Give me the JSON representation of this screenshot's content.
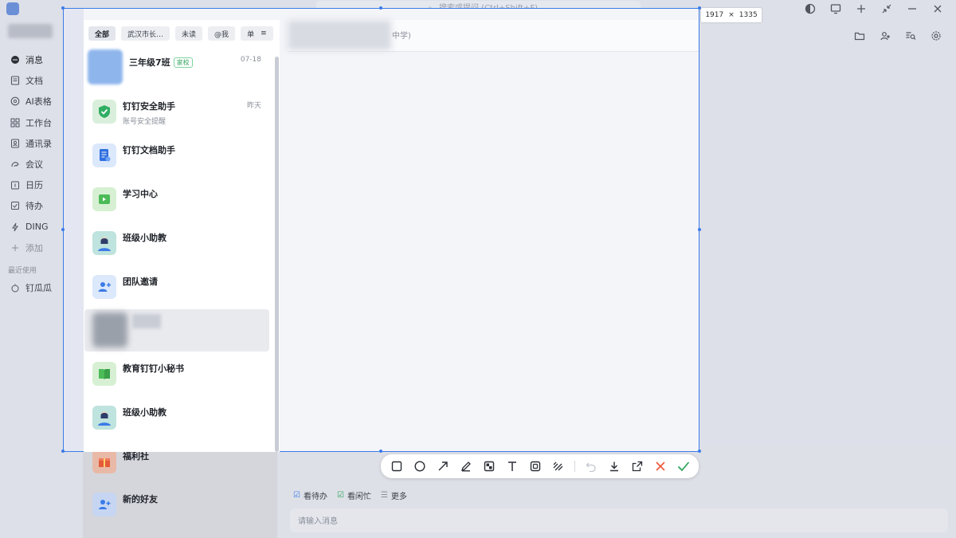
{
  "top_search": {
    "placeholder": "搜索或提问 (Ctrl+Shift+F)"
  },
  "nav": {
    "items": [
      {
        "label": "消息",
        "icon": "chat-bubble-icon"
      },
      {
        "label": "文档",
        "icon": "document-icon"
      },
      {
        "label": "AI表格",
        "icon": "ai-table-icon"
      },
      {
        "label": "工作台",
        "icon": "workbench-icon"
      },
      {
        "label": "通讯录",
        "icon": "contacts-icon"
      },
      {
        "label": "会议",
        "icon": "meeting-icon"
      },
      {
        "label": "日历",
        "icon": "calendar-icon"
      },
      {
        "label": "待办",
        "icon": "todo-icon"
      },
      {
        "label": "DING",
        "icon": "ding-icon"
      },
      {
        "label": "添加",
        "icon": "plus-icon"
      }
    ],
    "recent_label": "最近使用",
    "recent_items": [
      {
        "label": "钉瓜瓜",
        "icon": "app-icon"
      }
    ]
  },
  "filter_tabs": [
    "全部",
    "武汉市长…",
    "未读",
    "@我",
    "单"
  ],
  "conversations": [
    {
      "name": "三年级7班",
      "tag": "家校",
      "time": "07-18",
      "sub": ""
    },
    {
      "name": "钉钉安全助手",
      "tag": "",
      "time": "昨天",
      "sub": "账号安全提醒"
    },
    {
      "name": "钉钉文档助手",
      "tag": "",
      "time": "",
      "sub": ""
    },
    {
      "name": "学习中心",
      "tag": "",
      "time": "",
      "sub": ""
    },
    {
      "name": "班级小助教",
      "tag": "",
      "time": "",
      "sub": ""
    },
    {
      "name": "团队邀请",
      "tag": "",
      "time": "",
      "sub": ""
    },
    {
      "name": "",
      "tag": "",
      "time": "",
      "sub": ""
    },
    {
      "name": "教育钉钉小秘书",
      "tag": "",
      "time": "",
      "sub": ""
    },
    {
      "name": "班级小助教",
      "tag": "",
      "time": "",
      "sub": ""
    },
    {
      "name": "福利社",
      "tag": "",
      "time": "",
      "sub": ""
    },
    {
      "name": "新的好友",
      "tag": "",
      "time": "",
      "sub": ""
    }
  ],
  "chat_header": {
    "suffix": "中学)"
  },
  "chat_actions": [
    "看待办",
    "看闲忙",
    "更多"
  ],
  "message_input": {
    "placeholder": "请输入消息"
  },
  "capture_size": {
    "width": "1917",
    "x": "×",
    "height": "1335"
  },
  "colors": {
    "accent": "#3b7be8",
    "cancel": "#f0573b",
    "confirm": "#2aa35a"
  }
}
